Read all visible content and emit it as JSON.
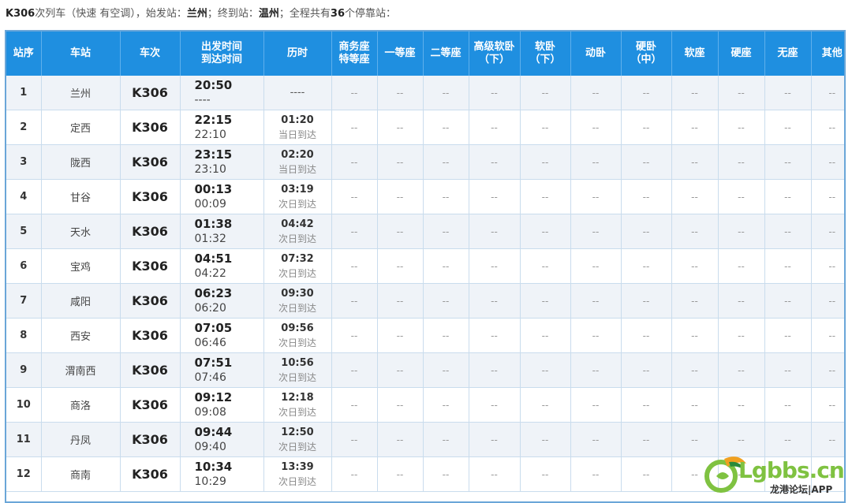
{
  "summary": {
    "train": "K306",
    "desc": "次列车（快速 有空调），始发站：",
    "origin": "兰州",
    "mid": "；终到站：",
    "dest": "温州",
    "mid2": "；全程共有",
    "count": "36",
    "tail": "个停靠站："
  },
  "headers": [
    "站序",
    "车站",
    "车次",
    "出发时间\n到达时间",
    "历时",
    "商务座\n特等座",
    "一等座",
    "二等座",
    "高级软卧\n（下）",
    "软卧\n（下）",
    "动卧",
    "硬卧\n（中）",
    "软座",
    "硬座",
    "无座",
    "其他"
  ],
  "seat_placeholder": "--",
  "rows": [
    {
      "seq": "1",
      "station": "兰州",
      "train": "K306",
      "dep": "20:50",
      "arr": "----",
      "dur": "----",
      "note": ""
    },
    {
      "seq": "2",
      "station": "定西",
      "train": "K306",
      "dep": "22:15",
      "arr": "22:10",
      "dur": "01:20",
      "note": "当日到达"
    },
    {
      "seq": "3",
      "station": "陇西",
      "train": "K306",
      "dep": "23:15",
      "arr": "23:10",
      "dur": "02:20",
      "note": "当日到达"
    },
    {
      "seq": "4",
      "station": "甘谷",
      "train": "K306",
      "dep": "00:13",
      "arr": "00:09",
      "dur": "03:19",
      "note": "次日到达"
    },
    {
      "seq": "5",
      "station": "天水",
      "train": "K306",
      "dep": "01:38",
      "arr": "01:32",
      "dur": "04:42",
      "note": "次日到达"
    },
    {
      "seq": "6",
      "station": "宝鸡",
      "train": "K306",
      "dep": "04:51",
      "arr": "04:22",
      "dur": "07:32",
      "note": "次日到达"
    },
    {
      "seq": "7",
      "station": "咸阳",
      "train": "K306",
      "dep": "06:23",
      "arr": "06:20",
      "dur": "09:30",
      "note": "次日到达"
    },
    {
      "seq": "8",
      "station": "西安",
      "train": "K306",
      "dep": "07:05",
      "arr": "06:46",
      "dur": "09:56",
      "note": "次日到达"
    },
    {
      "seq": "9",
      "station": "渭南西",
      "train": "K306",
      "dep": "07:51",
      "arr": "07:46",
      "dur": "10:56",
      "note": "次日到达"
    },
    {
      "seq": "10",
      "station": "商洛",
      "train": "K306",
      "dep": "09:12",
      "arr": "09:08",
      "dur": "12:18",
      "note": "次日到达"
    },
    {
      "seq": "11",
      "station": "丹凤",
      "train": "K306",
      "dep": "09:44",
      "arr": "09:40",
      "dur": "12:50",
      "note": "次日到达"
    },
    {
      "seq": "12",
      "station": "商南",
      "train": "K306",
      "dep": "10:34",
      "arr": "10:29",
      "dur": "13:39",
      "note": "次日到达"
    }
  ],
  "watermark": {
    "brand": "Lgbbs.cn",
    "sub": "龙港论坛|APP"
  },
  "colors": {
    "header_bg": "#1f8fe0",
    "row_alt": "#eff3f8",
    "brand_green": "#7fc241"
  }
}
